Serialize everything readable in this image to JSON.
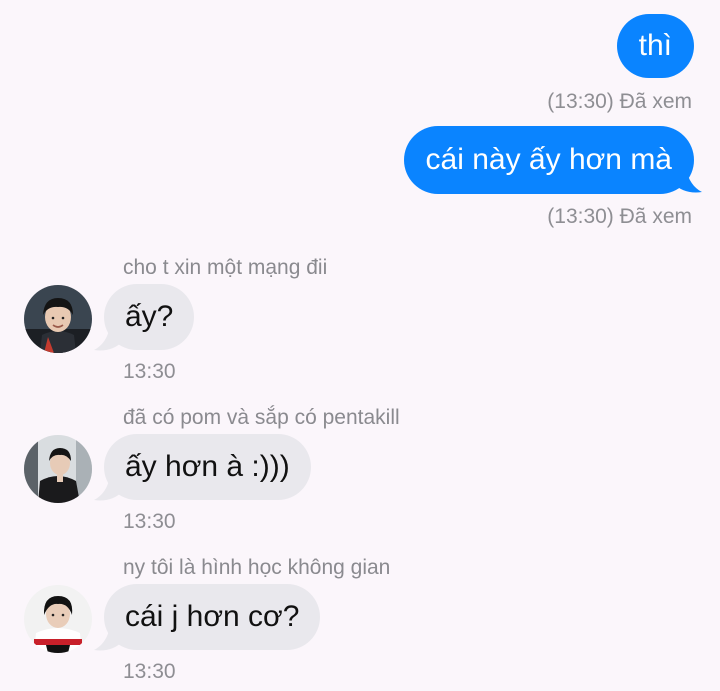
{
  "messages_out": [
    {
      "text": "thì",
      "status": "(13:30) Đã xem"
    },
    {
      "text": "cái này ấy hơn mà",
      "status": "(13:30) Đã xem"
    }
  ],
  "messages_in": [
    {
      "reply_note": "cho t xin một mạng đii",
      "text": "ấy?",
      "time": "13:30",
      "avatar": "avatar-1"
    },
    {
      "reply_note": "đã có pom và sắp có pentakill",
      "text": "ấy hơn à :)))",
      "time": "13:30",
      "avatar": "avatar-2"
    },
    {
      "reply_note": "ny tôi là hình học không gian",
      "text": "cái j hơn cơ?",
      "time": "13:30",
      "avatar": "avatar-3"
    }
  ],
  "colors": {
    "background": "#fbf6fb",
    "outgoing_bubble": "#0a84ff",
    "incoming_bubble": "#e9e8ed",
    "meta_text": "#8e8e93"
  }
}
